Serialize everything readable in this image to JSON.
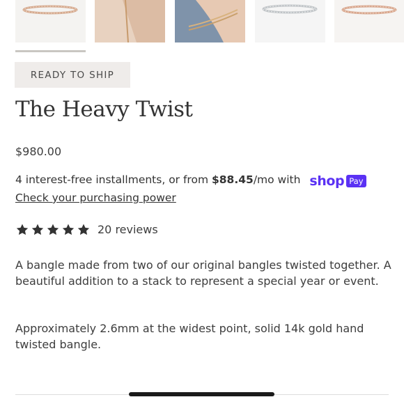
{
  "badge": {
    "label": "READY TO SHIP"
  },
  "product": {
    "title": "The Heavy Twist",
    "price": "$980.00"
  },
  "payment": {
    "text_before": "4 interest-free installments, or from ",
    "amount": "$88.45",
    "text_after": "/mo with ",
    "shop_word": "shop",
    "pay_word": "Pay",
    "link_text": "Check your purchasing power",
    "brand_color": "#5a31f4"
  },
  "rating": {
    "stars": 5,
    "reviews_label": "20 reviews"
  },
  "description": {
    "paragraph1": "A bangle made from two of our original bangles twisted together. A beautiful addition to a stack to represent a special year or event.",
    "paragraph2": "Approximately 2.6mm at the widest point, solid 14k gold hand twisted bangle."
  },
  "gallery": {
    "thumbnail_count": 5,
    "selected_index": 0
  }
}
